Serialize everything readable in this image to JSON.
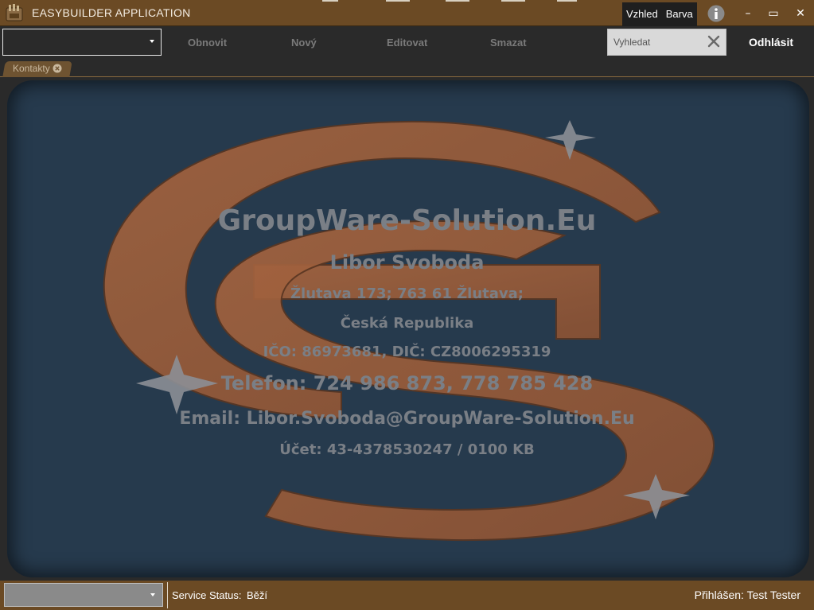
{
  "window": {
    "title": "EASYBUILDER APPLICATION",
    "theme_buttons": {
      "vzhled": "Vzhled",
      "barva": "Barva"
    },
    "controls": {
      "minimize": "–",
      "maximize": "▭",
      "close": "✕"
    }
  },
  "toolbar": {
    "selector_value": "",
    "refresh_label": "Obnovit",
    "new_label": "Nový",
    "edit_label": "Editovat",
    "delete_label": "Smazat",
    "search_placeholder": "Vyhledat",
    "logout_label": "Odhlásit"
  },
  "tabs": [
    {
      "label": "Kontakty"
    }
  ],
  "company": {
    "name": "GroupWare-Solution.Eu",
    "person": "Libor Svoboda",
    "address": "Žlutava 173; 763 61 Žlutava;",
    "country": "Česká Republika",
    "ids": "IČO: 86973681, DIČ: CZ8006295319",
    "phone": "Telefon: 724 986 873, 778 785 428",
    "email": "Email: Libor.Svoboda@GroupWare-Solution.Eu",
    "account": "Účet: 43-4378530247 / 0100 KB"
  },
  "statusbar": {
    "selector_value": "",
    "service_label": "Service Status:",
    "service_value": "Běží",
    "logged_in": "Přihlášen: Test Tester"
  },
  "colors": {
    "titlebar": "#6b4a24",
    "toolbar": "#2a2a2a",
    "card_background": "#263a4d",
    "logo_accent": "#9a5c3c",
    "disabled_text": "#7a7a7a"
  },
  "icons": [
    "app-logo-icon",
    "info-icon",
    "minimize-icon",
    "maximize-icon",
    "close-icon",
    "dropdown-arrow-icon",
    "search-clear-icon",
    "tab-close-icon"
  ]
}
